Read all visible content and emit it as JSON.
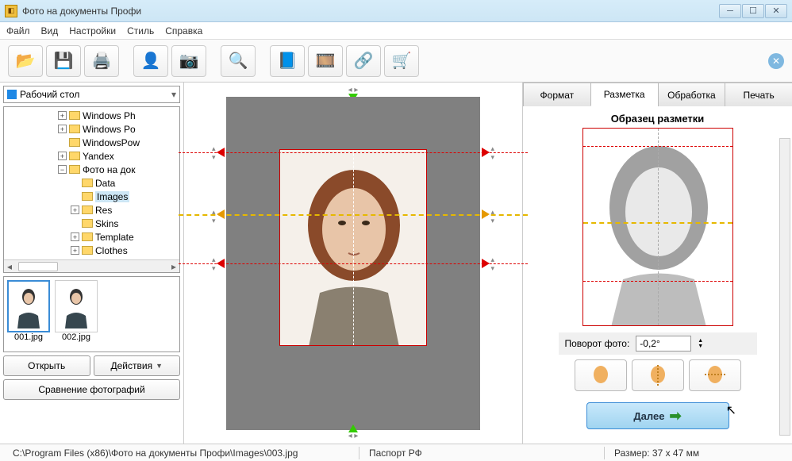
{
  "window": {
    "title": "Фото на документы Профи"
  },
  "menu": [
    "Файл",
    "Вид",
    "Настройки",
    "Стиль",
    "Справка"
  ],
  "folder_dropdown": "Рабочий стол",
  "tree": [
    {
      "indent": 0,
      "box": "+",
      "label": "Windows Ph"
    },
    {
      "indent": 0,
      "box": "+",
      "label": "Windows Po"
    },
    {
      "indent": 0,
      "box": "",
      "label": "WindowsPow"
    },
    {
      "indent": 0,
      "box": "+",
      "label": "Yandex"
    },
    {
      "indent": 0,
      "box": "−",
      "label": "Фото на док"
    },
    {
      "indent": 1,
      "box": "",
      "label": "Data"
    },
    {
      "indent": 1,
      "box": "",
      "label": "Images",
      "selected": true
    },
    {
      "indent": 1,
      "box": "+",
      "label": "Res"
    },
    {
      "indent": 1,
      "box": "",
      "label": "Skins"
    },
    {
      "indent": 1,
      "box": "+",
      "label": "Template"
    },
    {
      "indent": 1,
      "box": "+",
      "label": "Clothes"
    }
  ],
  "thumbnails": [
    {
      "name": "001.jpg",
      "selected": true
    },
    {
      "name": "002.jpg",
      "selected": false
    }
  ],
  "buttons": {
    "open": "Открыть",
    "actions": "Действия",
    "compare": "Сравнение фотографий",
    "next": "Далее"
  },
  "tabs": [
    "Формат",
    "Разметка",
    "Обработка",
    "Печать"
  ],
  "active_tab": "Разметка",
  "sample_title": "Образец разметки",
  "rotation": {
    "label": "Поворот фото:",
    "value": "-0,2°"
  },
  "status": {
    "path": "C:\\Program Files (x86)\\Фото на документы Профи\\Images\\003.jpg",
    "format": "Паспорт РФ",
    "size": "Размер: 37 x 47 мм"
  }
}
